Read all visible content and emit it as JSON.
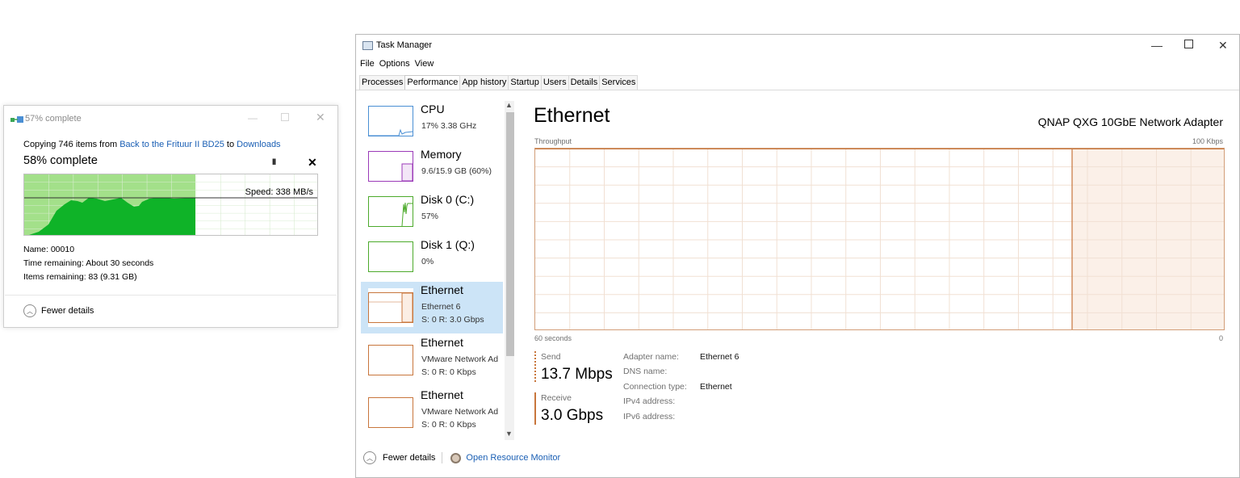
{
  "copy_dialog": {
    "title": "57% complete",
    "copy_prefix": "Copying 746 items from ",
    "source_link": "Back to the Frituur II BD25",
    "to_text": " to ",
    "dest_link": "Downloads",
    "percent_text": "58% complete",
    "pause_label": "II",
    "stop_label": "✕",
    "speed_text": "Speed: 338 MB/s",
    "progress": 0.58,
    "name_text": "Name: 00010",
    "time_text": "Time remaining: About 30 seconds",
    "items_text": "Items remaining: 83 (9.31 GB)",
    "fewer_details": "Fewer details",
    "colors": {
      "fill": "#0fb328",
      "done_bg": "#a3e08a"
    }
  },
  "task_manager": {
    "title": "Task Manager",
    "menu": [
      "File",
      "Options",
      "View"
    ],
    "tabs": [
      "Processes",
      "Performance",
      "App history",
      "Startup",
      "Users",
      "Details",
      "Services"
    ],
    "active_tab": "Performance",
    "sidebar": [
      {
        "name": "CPU",
        "sub1": "17% 3.38 GHz",
        "sub2": "",
        "color": "#4a8fd4"
      },
      {
        "name": "Memory",
        "sub1": "9.6/15.9 GB (60%)",
        "sub2": "",
        "color": "#9b3ab8"
      },
      {
        "name": "Disk 0 (C:)",
        "sub1": "57%",
        "sub2": "",
        "color": "#4caa2b"
      },
      {
        "name": "Disk 1 (Q:)",
        "sub1": "0%",
        "sub2": "",
        "color": "#4caa2b"
      },
      {
        "name": "Ethernet",
        "sub1": "Ethernet 6",
        "sub2": "S: 0 R: 3.0 Gbps",
        "color": "#c8763c"
      },
      {
        "name": "Ethernet",
        "sub1": "VMware Network Ad",
        "sub2": "S: 0 R: 0 Kbps",
        "color": "#c8763c"
      },
      {
        "name": "Ethernet",
        "sub1": "VMware Network Ad",
        "sub2": "S: 0 R: 0 Kbps",
        "color": "#c8763c"
      }
    ],
    "main": {
      "title": "Ethernet",
      "adapter": "QNAP QXG 10GbE Network Adapter",
      "throughput_label": "Throughput",
      "max_label": "100 Kbps",
      "time_label": "60 seconds",
      "min_label": "0",
      "send_label": "Send",
      "send_value": "13.7 Mbps",
      "receive_label": "Receive",
      "receive_value": "3.0 Gbps",
      "props": [
        {
          "label": "Adapter name:",
          "value": "Ethernet 6"
        },
        {
          "label": "DNS name:",
          "value": ""
        },
        {
          "label": "Connection type:",
          "value": "Ethernet"
        },
        {
          "label": "IPv4 address:",
          "value": ""
        },
        {
          "label": "IPv6 address:",
          "value": ""
        }
      ],
      "accent": "#c8763c"
    },
    "footer": {
      "fewer_details": "Fewer details",
      "resource_monitor": "Open Resource Monitor"
    }
  }
}
